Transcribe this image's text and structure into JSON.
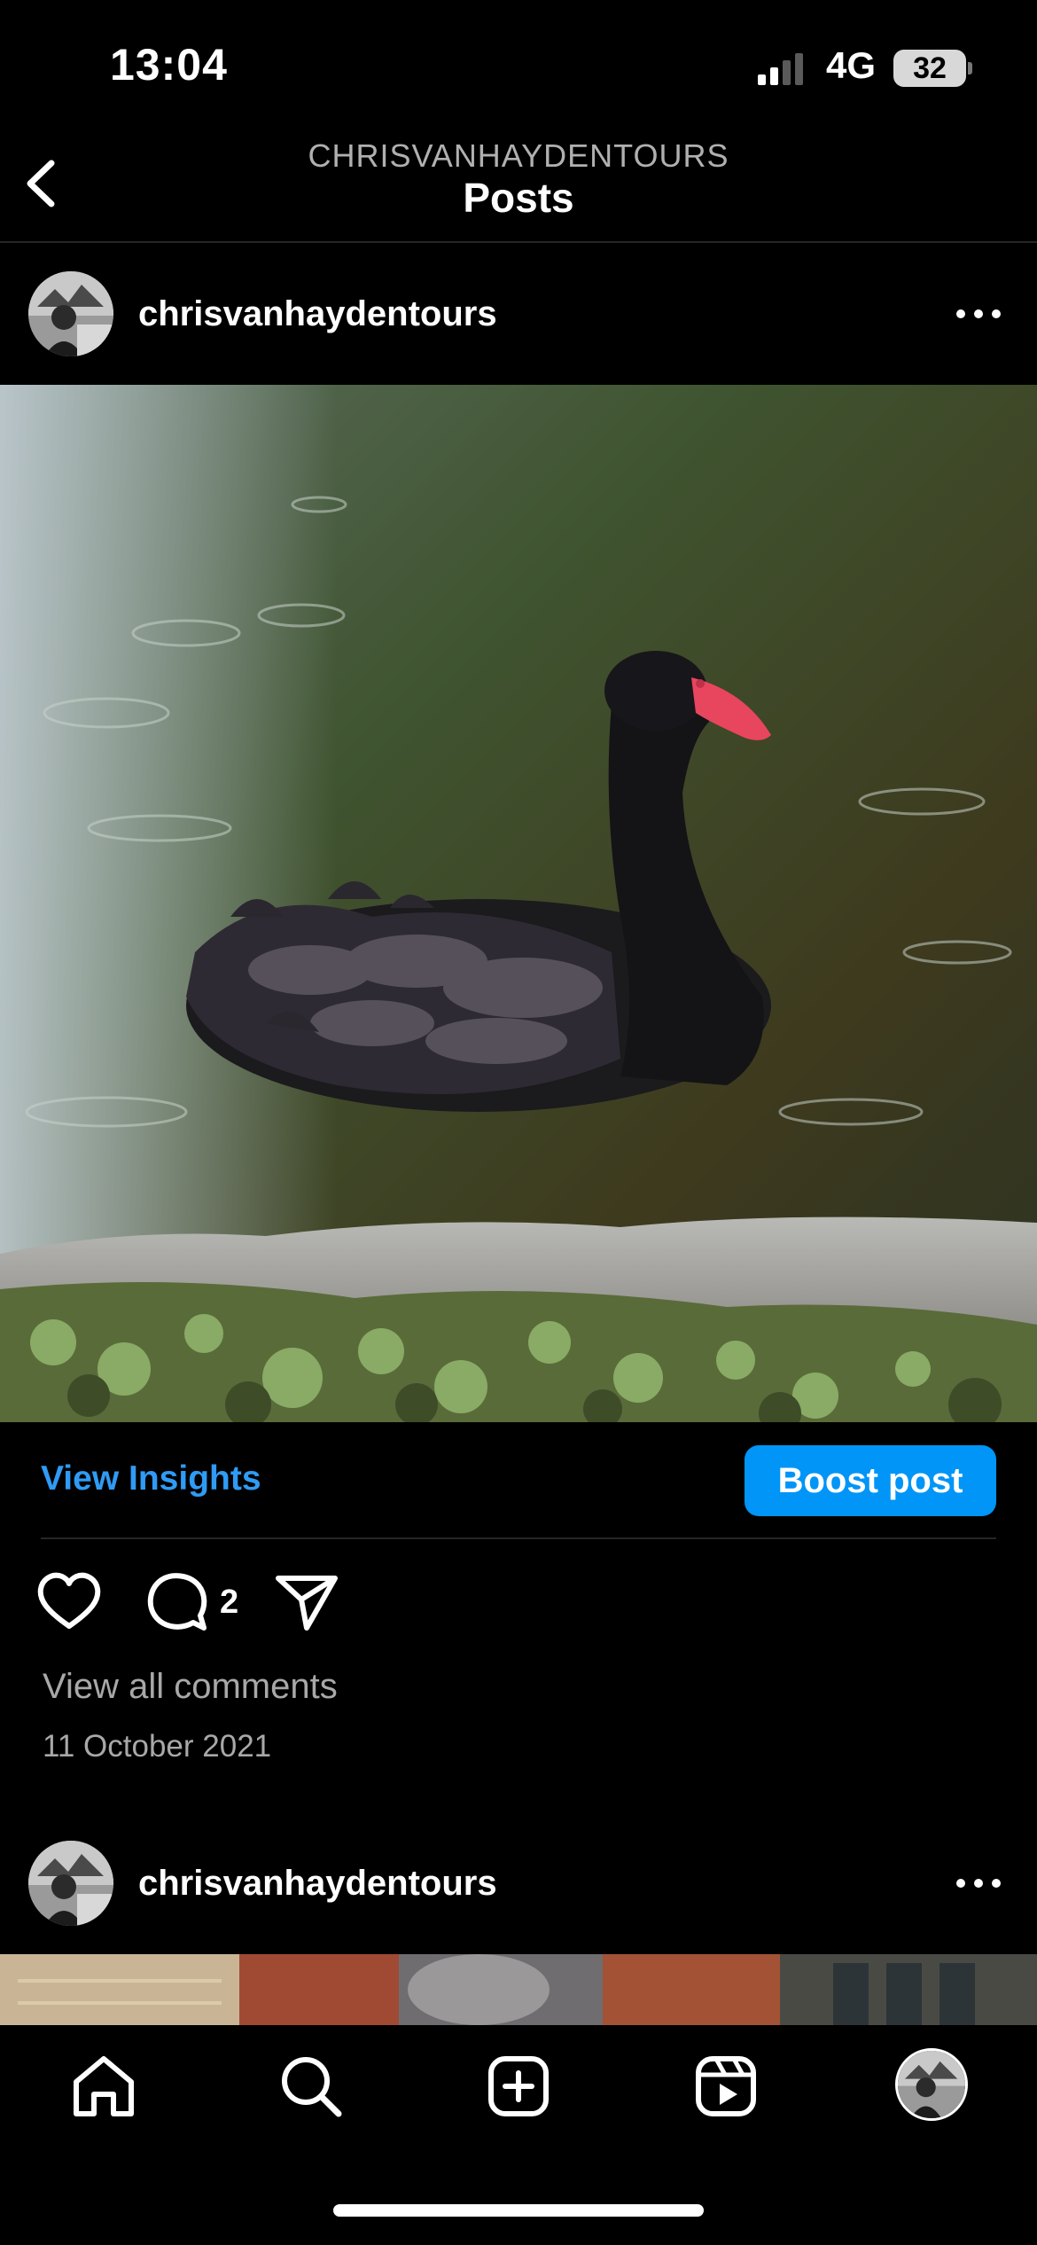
{
  "status_bar": {
    "time": "13:04",
    "network": "4G",
    "battery": "32"
  },
  "header": {
    "account_label": "CHRISVANHAYDENTOURS",
    "title": "Posts",
    "back_icon": "chevron-left-icon"
  },
  "posts": [
    {
      "username": "chrisvanhaydentours",
      "more_icon": "more-horizontal-icon",
      "view_insights": "View Insights",
      "boost": "Boost post",
      "comment_count": "2",
      "view_comments": "View all comments",
      "date": "11 October 2021"
    },
    {
      "username": "chrisvanhaydentours",
      "more_icon": "more-horizontal-icon"
    }
  ],
  "tab_bar": {
    "items": [
      "home-icon",
      "search-icon",
      "create-icon",
      "reels-icon",
      "profile-avatar"
    ]
  },
  "colors": {
    "accent": "#0095f6",
    "link": "#2f9bf5",
    "background": "#000000"
  }
}
